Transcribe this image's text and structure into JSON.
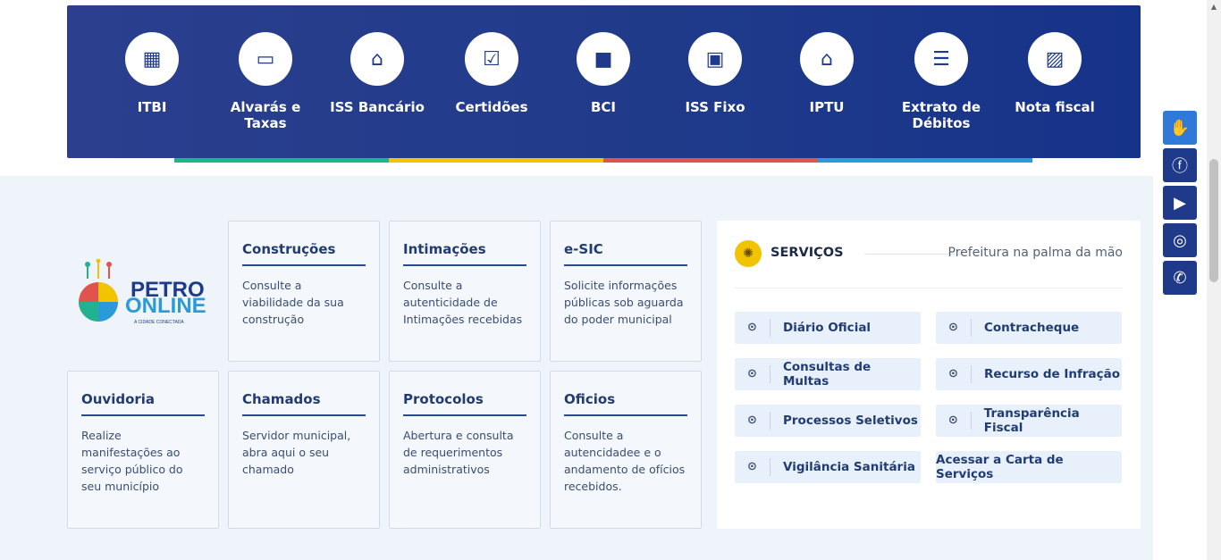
{
  "quick_links": [
    {
      "icon": "building-icon",
      "glyph": "▦",
      "label": "ITBI"
    },
    {
      "icon": "money-icon",
      "glyph": "▭",
      "label": "Alvarás e Taxas"
    },
    {
      "icon": "bank-icon",
      "glyph": "⌂",
      "label": "ISS Bancário"
    },
    {
      "icon": "clipboard-icon",
      "glyph": "☑",
      "label": "Certidões"
    },
    {
      "icon": "card-icon",
      "glyph": "■",
      "label": "BCI"
    },
    {
      "icon": "document-icon",
      "glyph": "▣",
      "label": "ISS Fixo"
    },
    {
      "icon": "house-icon",
      "glyph": "⌂",
      "label": "IPTU"
    },
    {
      "icon": "receipt-icon",
      "glyph": "☰",
      "label": "Extrato de Débitos"
    },
    {
      "icon": "invoice-icon",
      "glyph": "▨",
      "label": "Nota fiscal"
    }
  ],
  "stripe_colors": [
    "#21b28f",
    "#f2c400",
    "#e0534f",
    "#2a9bd8"
  ],
  "logo": {
    "line1": "PETRO",
    "line2": "ONLINE",
    "tagline": "A CIDADE CONECTADA"
  },
  "cards": {
    "construcoes": {
      "title": "Construções",
      "desc": "Consulte a viabilidade da sua construção"
    },
    "intimacoes": {
      "title": "Intimações",
      "desc": "Consulte a autenticidade de Intimações recebidas"
    },
    "esic": {
      "title": "e-SIC",
      "desc": "Solicite informações públicas sob aguarda do poder municipal"
    },
    "ouvidoria": {
      "title": "Ouvidoria",
      "desc": "Realize manifestações ao serviço público do seu município"
    },
    "chamados": {
      "title": "Chamados",
      "desc": "Servidor municipal, abra aqui o seu chamado"
    },
    "protocolos": {
      "title": "Protocolos",
      "desc": "Abertura e consulta de requerimentos administrativos"
    },
    "oficios": {
      "title": "Oficios",
      "desc": "Consulte a autencidadee e o andamento de ofícios recebidos."
    }
  },
  "services": {
    "title": "SERVIÇOS",
    "subtitle": "Prefeitura na palma da mão",
    "items": [
      "Diário Oficial",
      "Contracheque",
      "Consultas de Multas",
      "Recurso de Infração",
      "Processos Seletivos",
      "Transparência Fiscal",
      "Vigilância Sanitária"
    ],
    "cta": "Acessar a Carta de Serviços"
  },
  "social": [
    {
      "icon": "accessibility-hands-icon",
      "glyph": "✋"
    },
    {
      "icon": "facebook-icon",
      "glyph": "ⓕ"
    },
    {
      "icon": "youtube-icon",
      "glyph": "▶"
    },
    {
      "icon": "instagram-icon",
      "glyph": "◎"
    },
    {
      "icon": "whatsapp-icon",
      "glyph": "✆"
    }
  ],
  "colors": {
    "brand": "#1f3a8a",
    "accent": "#f2c400",
    "background": "#eff4fa"
  }
}
